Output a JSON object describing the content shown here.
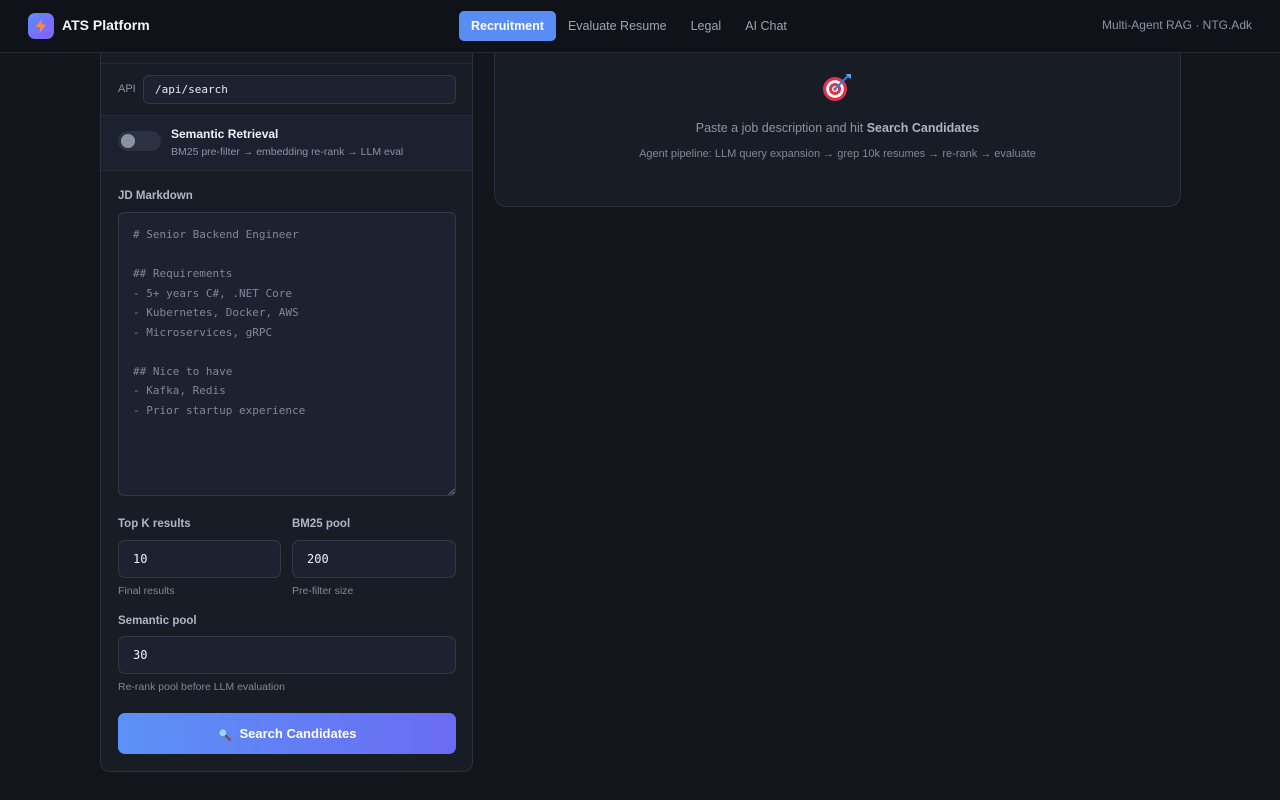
{
  "header": {
    "brand": "ATS Platform",
    "tabs": [
      {
        "label": "Recruitment",
        "active": true
      },
      {
        "label": "Evaluate Resume",
        "active": false
      },
      {
        "label": "Legal",
        "active": false
      },
      {
        "label": "AI Chat",
        "active": false
      }
    ],
    "right_text": "Multi-Agent RAG · NTG.Adk"
  },
  "form": {
    "api_label": "API",
    "api_value": "/api/search",
    "semantic": {
      "title": "Semantic Retrieval",
      "subtitle": "BM25 pre-filter → embedding re-rank → LLM eval",
      "enabled": false
    },
    "jd_label": "JD Markdown",
    "jd_placeholder": "# Senior Backend Engineer\n\n## Requirements\n- 5+ years C#, .NET Core\n- Kubernetes, Docker, AWS\n- Microservices, gRPC\n\n## Nice to have\n- Kafka, Redis\n- Prior startup experience",
    "top_k": {
      "label": "Top K results",
      "value": "10",
      "hint": "Final results"
    },
    "bm25_pool": {
      "label": "BM25 pool",
      "value": "200",
      "hint": "Pre-filter size"
    },
    "semantic_pool": {
      "label": "Semantic pool",
      "value": "30",
      "hint": "Re-rank pool before LLM evaluation"
    },
    "search_button": "Search Candidates"
  },
  "empty_state": {
    "icon": "target-icon",
    "message_prefix": "Paste a job description and hit ",
    "message_bold": "Search Candidates",
    "pipeline": "Agent pipeline: LLM query expansion → grep 10k resumes → re-rank → evaluate"
  },
  "colors": {
    "accent": "#5a8cf6",
    "button_gradient_start": "#5b92f7",
    "button_gradient_end": "#6a6cf2",
    "background": "#12151c",
    "panel": "#181c25"
  }
}
